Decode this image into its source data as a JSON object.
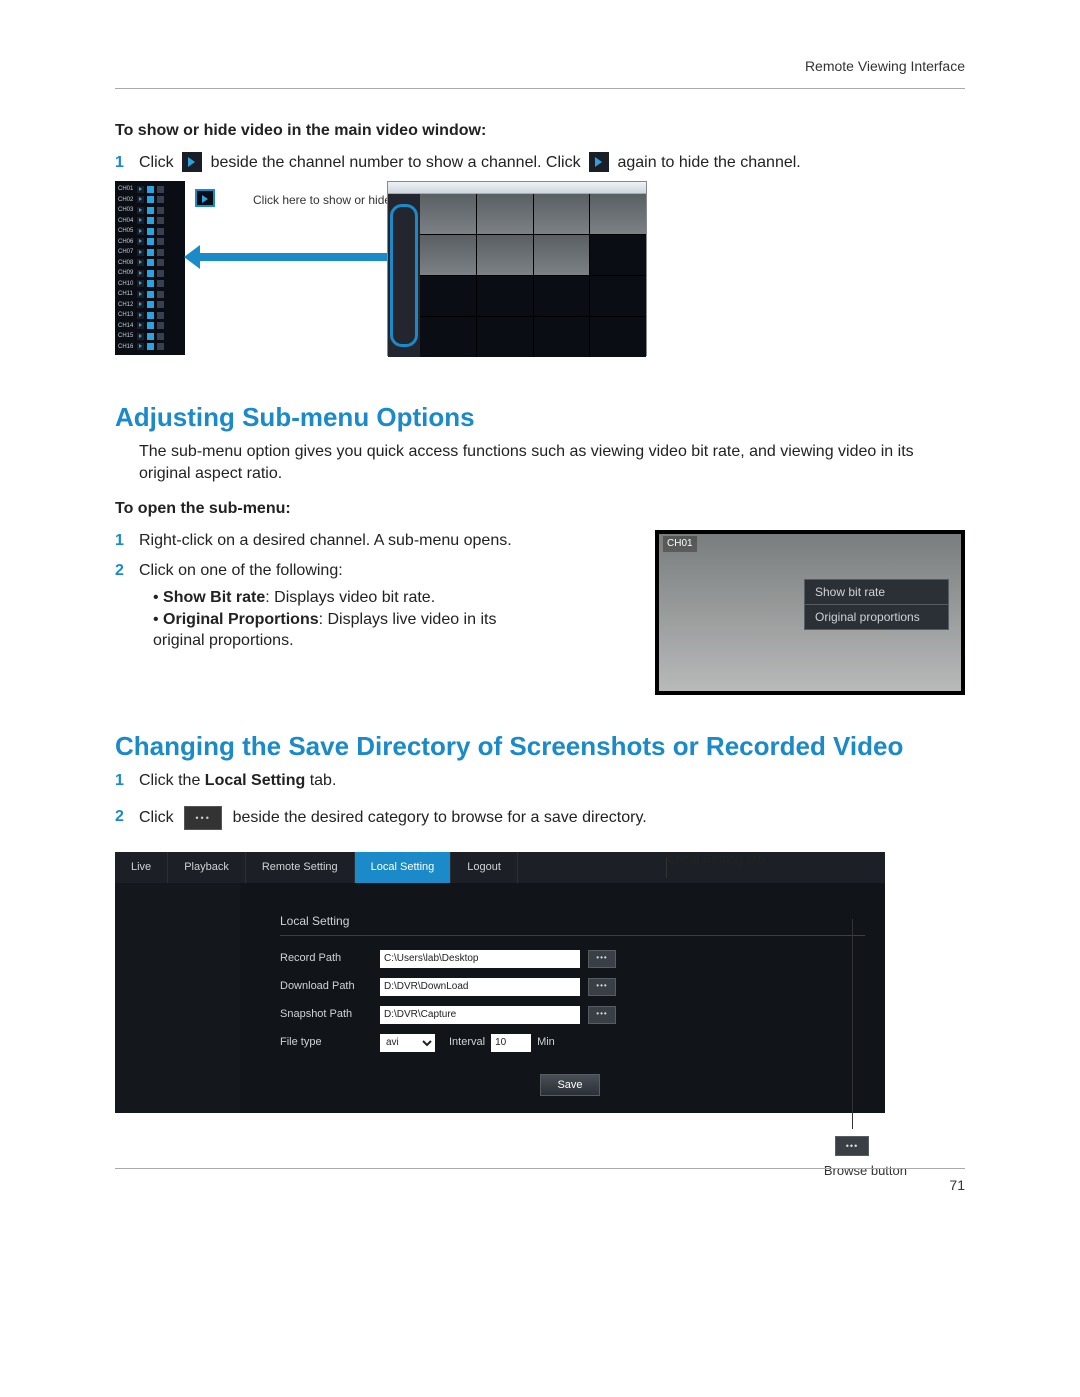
{
  "header": {
    "running_head": "Remote Viewing Interface"
  },
  "page_number": "71",
  "section1": {
    "lead": "To show or hide video in the main video window:",
    "step1_a": "Click",
    "step1_b": "beside the channel number to show a channel. Click",
    "step1_c": "again to hide the channel.",
    "fig_annot": "Click here to show or hide video",
    "channels": [
      "CH01",
      "CH02",
      "CH03",
      "CH04",
      "CH05",
      "CH06",
      "CH07",
      "CH08",
      "CH09",
      "CH10",
      "CH11",
      "CH12",
      "CH13",
      "CH14",
      "CH15",
      "CH16"
    ]
  },
  "section2": {
    "heading": "Adjusting Sub-menu Options",
    "intro": "The sub-menu option gives you quick access functions such as viewing video bit rate, and viewing video in its original aspect ratio.",
    "lead": "To open the sub-menu:",
    "step1": "Right-click on a desired channel. A sub-menu opens.",
    "step2": "Click on one of the following:",
    "bullet1_bold": "Show Bit rate",
    "bullet1_rest": ": Displays video bit rate.",
    "bullet2_bold": "Original Proportions",
    "bullet2_rest": ": Displays live video in its original proportions.",
    "fig_channel": "CH01",
    "ctx1": "Show bit rate",
    "ctx2": "Original proportions"
  },
  "section3": {
    "heading": "Changing the Save Directory of Screenshots or Recorded Video",
    "step1_a": "Click the ",
    "step1_bold": "Local Setting",
    "step1_b": " tab.",
    "step2_a": "Click",
    "step2_b": "beside the desired category to browse for a save directory.",
    "label_top": "Local Setting tab",
    "label_bottom": "Browse button"
  },
  "local_setting": {
    "tabs": [
      "Live",
      "Playback",
      "Remote Setting",
      "Local Setting",
      "Logout"
    ],
    "panel_title": "Local Setting",
    "rows": {
      "record_label": "Record Path",
      "record_value": "C:\\Users\\lab\\Desktop",
      "download_label": "Download Path",
      "download_value": "D:\\DVR\\DownLoad",
      "snapshot_label": "Snapshot Path",
      "snapshot_value": "D:\\DVR\\Capture",
      "filetype_label": "File type",
      "filetype_value": "avi",
      "interval_label": "Interval",
      "interval_value": "10",
      "interval_unit": "Min"
    },
    "save": "Save"
  }
}
